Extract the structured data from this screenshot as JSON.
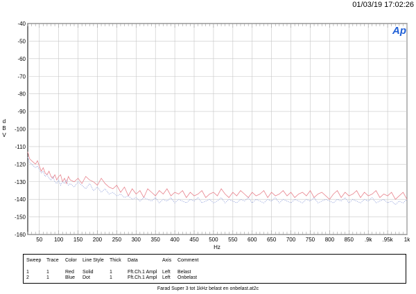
{
  "timestamp": "01/03/19 17:02:26",
  "logo_text": "Ap",
  "colors": {
    "red": "#e8838d",
    "blue": "#8a9bd9",
    "grid": "#c6c6c6",
    "logo": "#1f5fd6"
  },
  "chart_data": {
    "type": "line",
    "xlabel": "Hz",
    "ylabel_chars": [
      "d",
      "B",
      "V"
    ],
    "xlim": [
      20,
      1000
    ],
    "ylim": [
      -160,
      -40
    ],
    "x_ticks": [
      {
        "v": 50,
        "label": "50"
      },
      {
        "v": 100,
        "label": "100"
      },
      {
        "v": 150,
        "label": "150"
      },
      {
        "v": 200,
        "label": "200"
      },
      {
        "v": 250,
        "label": "250"
      },
      {
        "v": 300,
        "label": "300"
      },
      {
        "v": 350,
        "label": "350"
      },
      {
        "v": 400,
        "label": "400"
      },
      {
        "v": 450,
        "label": "450"
      },
      {
        "v": 500,
        "label": "500"
      },
      {
        "v": 550,
        "label": "550"
      },
      {
        "v": 600,
        "label": "600"
      },
      {
        "v": 650,
        "label": "650"
      },
      {
        "v": 700,
        "label": "700"
      },
      {
        "v": 750,
        "label": "750"
      },
      {
        "v": 800,
        "label": "800"
      },
      {
        "v": 850,
        "label": "850"
      },
      {
        "v": 900,
        "label": ".9k"
      },
      {
        "v": 950,
        "label": ".95k"
      },
      {
        "v": 1000,
        "label": "1k"
      }
    ],
    "y_ticks": [
      -40,
      -50,
      -60,
      -70,
      -80,
      -90,
      -100,
      -110,
      -120,
      -130,
      -140,
      -150,
      -160
    ],
    "grid": true,
    "series": [
      {
        "color": "red",
        "style": "solid",
        "x": [
          20,
          25,
          30,
          35,
          40,
          45,
          50,
          55,
          60,
          65,
          70,
          75,
          80,
          85,
          90,
          95,
          100,
          105,
          110,
          115,
          120,
          125,
          130,
          140,
          150,
          160,
          170,
          180,
          190,
          200,
          210,
          220,
          230,
          240,
          250,
          260,
          270,
          280,
          290,
          300,
          310,
          320,
          330,
          340,
          350,
          360,
          370,
          380,
          390,
          400,
          410,
          420,
          430,
          440,
          450,
          460,
          470,
          480,
          490,
          500,
          510,
          520,
          530,
          540,
          550,
          560,
          570,
          580,
          590,
          600,
          610,
          620,
          630,
          640,
          650,
          660,
          670,
          680,
          690,
          700,
          710,
          720,
          730,
          740,
          750,
          760,
          770,
          780,
          790,
          800,
          810,
          820,
          830,
          840,
          850,
          860,
          870,
          880,
          890,
          900,
          910,
          920,
          930,
          940,
          950,
          960,
          970,
          980,
          990,
          1000
        ],
        "y": [
          -113,
          -117,
          -118,
          -119,
          -120,
          -118,
          -121,
          -124,
          -122,
          -125,
          -126,
          -124,
          -127,
          -128,
          -126,
          -129,
          -127,
          -126,
          -130,
          -128,
          -131,
          -127,
          -129,
          -130,
          -128,
          -131,
          -127,
          -129,
          -130,
          -132,
          -128,
          -131,
          -133,
          -134,
          -132,
          -136,
          -133,
          -138,
          -134,
          -137,
          -135,
          -139,
          -134,
          -136,
          -138,
          -135,
          -137,
          -134,
          -138,
          -136,
          -137,
          -135,
          -139,
          -136,
          -138,
          -137,
          -135,
          -139,
          -137,
          -136,
          -138,
          -134,
          -137,
          -139,
          -136,
          -138,
          -135,
          -137,
          -139,
          -136,
          -138,
          -137,
          -135,
          -139,
          -136,
          -138,
          -137,
          -135,
          -138,
          -136,
          -139,
          -137,
          -136,
          -138,
          -135,
          -139,
          -137,
          -136,
          -138,
          -140,
          -137,
          -135,
          -139,
          -136,
          -138,
          -137,
          -135,
          -139,
          -136,
          -138,
          -137,
          -135,
          -139,
          -137,
          -138,
          -136,
          -140,
          -138,
          -136,
          -140
        ]
      },
      {
        "color": "blue",
        "style": "dot",
        "x": [
          20,
          25,
          30,
          35,
          40,
          45,
          50,
          55,
          60,
          65,
          70,
          75,
          80,
          85,
          90,
          95,
          100,
          105,
          110,
          115,
          120,
          125,
          130,
          140,
          150,
          160,
          170,
          180,
          190,
          200,
          210,
          220,
          230,
          240,
          250,
          260,
          270,
          280,
          290,
          300,
          310,
          320,
          330,
          340,
          350,
          360,
          370,
          380,
          390,
          400,
          410,
          420,
          430,
          440,
          450,
          460,
          470,
          480,
          490,
          500,
          510,
          520,
          530,
          540,
          550,
          560,
          570,
          580,
          590,
          600,
          610,
          620,
          630,
          640,
          650,
          660,
          670,
          680,
          690,
          700,
          710,
          720,
          730,
          740,
          750,
          760,
          770,
          780,
          790,
          800,
          810,
          820,
          830,
          840,
          850,
          860,
          870,
          880,
          890,
          900,
          910,
          920,
          930,
          940,
          950,
          960,
          970,
          980,
          990,
          1000
        ],
        "y": [
          -116,
          -119,
          -120,
          -121,
          -122,
          -121,
          -123,
          -125,
          -124,
          -127,
          -126,
          -128,
          -129,
          -127,
          -130,
          -131,
          -129,
          -132,
          -130,
          -131,
          -129,
          -132,
          -131,
          -133,
          -130,
          -132,
          -134,
          -131,
          -135,
          -133,
          -136,
          -134,
          -137,
          -136,
          -138,
          -137,
          -139,
          -138,
          -140,
          -139,
          -141,
          -139,
          -140,
          -141,
          -139,
          -142,
          -140,
          -141,
          -139,
          -142,
          -140,
          -141,
          -142,
          -140,
          -141,
          -139,
          -142,
          -141,
          -140,
          -142,
          -141,
          -139,
          -142,
          -140,
          -141,
          -142,
          -140,
          -141,
          -139,
          -142,
          -140,
          -141,
          -142,
          -140,
          -141,
          -139,
          -142,
          -140,
          -141,
          -142,
          -140,
          -141,
          -142,
          -140,
          -141,
          -139,
          -142,
          -141,
          -140,
          -141,
          -142,
          -140,
          -141,
          -139,
          -142,
          -140,
          -141,
          -142,
          -140,
          -141,
          -139,
          -142,
          -141,
          -140,
          -142,
          -141,
          -143,
          -141,
          -142,
          -140
        ]
      }
    ]
  },
  "legend_table": {
    "headers": [
      "Sweep",
      "Trace",
      "Color",
      "Line Style",
      "Thick",
      "Data",
      "Axis",
      "Comment"
    ],
    "rows": [
      [
        "1",
        "1",
        "Red",
        "Solid",
        "1",
        "Fft.Ch.1 Ampl",
        "Left",
        "Belast"
      ],
      [
        "2",
        "1",
        "Blue",
        "Dot",
        "1",
        "Fft.Ch.1 Ampl",
        "Left",
        "Onbelast"
      ]
    ]
  },
  "filename": "Farad Super 3 tot 1kHz belast en onbelast.at2c"
}
